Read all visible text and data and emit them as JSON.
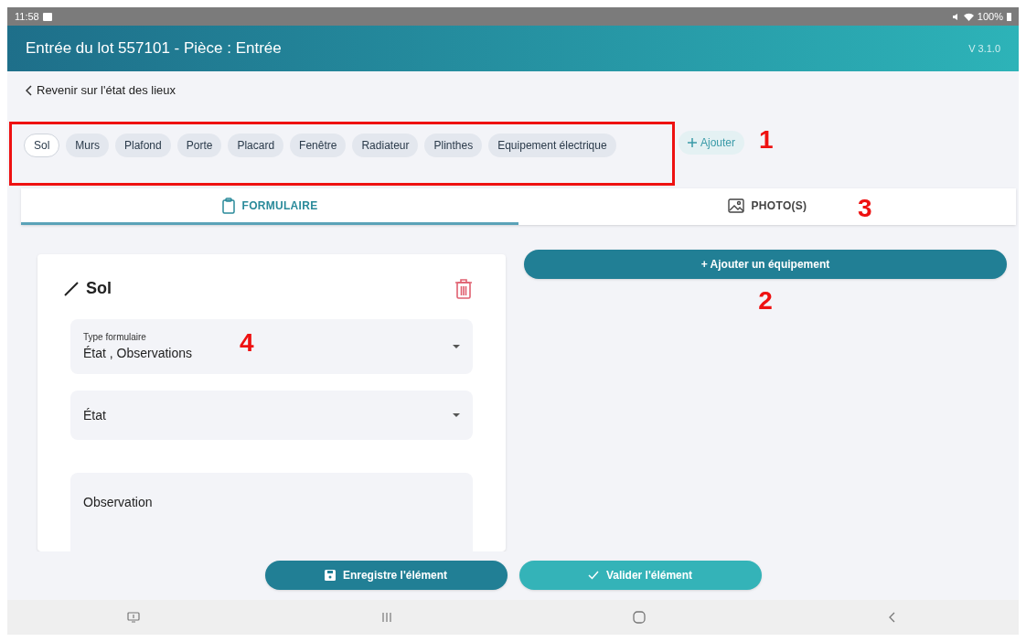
{
  "status_bar": {
    "time": "11:58",
    "battery": "100%"
  },
  "header": {
    "title": "Entrée du lot 557101 - Pièce : Entrée",
    "version": "V 3.1.0"
  },
  "back_link": "Revenir sur l'état des lieux",
  "chips": [
    {
      "label": "Sol",
      "selected": true
    },
    {
      "label": "Murs",
      "selected": false
    },
    {
      "label": "Plafond",
      "selected": false
    },
    {
      "label": "Porte",
      "selected": false
    },
    {
      "label": "Placard",
      "selected": false
    },
    {
      "label": "Fenêtre",
      "selected": false
    },
    {
      "label": "Radiateur",
      "selected": false
    },
    {
      "label": "Plinthes",
      "selected": false
    },
    {
      "label": "Equipement électrique",
      "selected": false
    }
  ],
  "add_chip": "Ajouter",
  "tabs": [
    {
      "label": "FORMULAIRE",
      "kind": "form",
      "selected": true
    },
    {
      "label": "PHOTO(S)",
      "kind": "photos",
      "selected": false
    }
  ],
  "card": {
    "title": "Sol",
    "fields": [
      {
        "kind": "select",
        "label": "Type formulaire",
        "value": "État , Observations"
      },
      {
        "kind": "select",
        "placeholder": "État"
      },
      {
        "kind": "textarea",
        "placeholder": "Observation"
      }
    ]
  },
  "add_equipment_button": "+ Ajouter un équipement",
  "footer_buttons": [
    {
      "label": "Enregistre l'élément",
      "kind": "save"
    },
    {
      "label": "Valider l'élément",
      "kind": "validate"
    }
  ],
  "annotations": [
    "1",
    "2",
    "3",
    "4"
  ]
}
